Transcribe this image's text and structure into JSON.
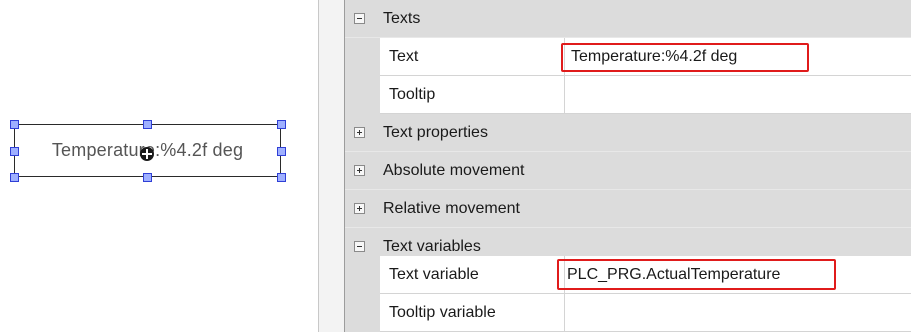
{
  "canvas": {
    "element_text": "Temperature:%4.2f deg"
  },
  "properties": [
    {
      "kind": "category",
      "label": "Texts",
      "expanded": true
    },
    {
      "kind": "property",
      "label": "Text",
      "value": "Temperature:%4.2f deg",
      "highlighted": true
    },
    {
      "kind": "property",
      "label": "Tooltip",
      "value": ""
    },
    {
      "kind": "category",
      "label": "Text properties",
      "expanded": false
    },
    {
      "kind": "category",
      "label": "Absolute movement",
      "expanded": false
    },
    {
      "kind": "category",
      "label": "Relative movement",
      "expanded": false
    },
    {
      "kind": "category",
      "label": "Text variables",
      "expanded": true
    },
    {
      "kind": "property",
      "label": "Text variable",
      "value": "PLC_PRG.ActualTemperature",
      "highlighted": true
    },
    {
      "kind": "property",
      "label": "Tooltip variable",
      "value": ""
    }
  ],
  "colors": {
    "highlight_border": "#e01b1b",
    "selection_handle": "#2f3fd6",
    "category_background": "#dcdcdc"
  }
}
